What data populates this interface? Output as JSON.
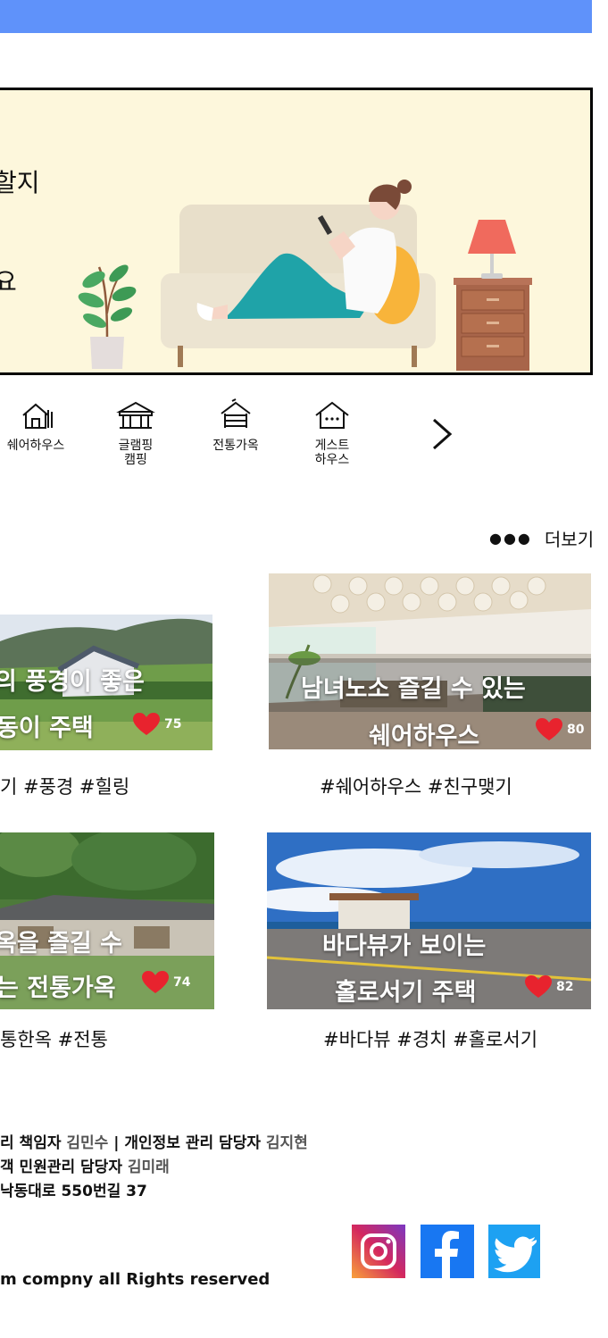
{
  "banner": {
    "line1": "할지",
    "line2": "요"
  },
  "categories": [
    {
      "label": "쉐어하우스",
      "icon": "share-house-icon"
    },
    {
      "label": "글램핑\n캠핑",
      "icon": "glamping-icon"
    },
    {
      "label": "전통가옥",
      "icon": "traditional-house-icon"
    },
    {
      "label": "게스트\n하우스",
      "icon": "guest-house-icon"
    }
  ],
  "more_label": "더보기",
  "cards": [
    {
      "title1": "의 풍경이 좋은",
      "title2": "동이 주택",
      "likes": "75",
      "tags": "기 #풍경 #힐링"
    },
    {
      "title1": "남녀노소 즐길 수 있는",
      "title2": "쉐어하우스",
      "likes": "80",
      "tags": "#쉐어하우스 #친구맺기"
    },
    {
      "title1": "옥을 즐길 수",
      "title2": "는 전통가옥",
      "likes": "74",
      "tags": "통한옥 #전통"
    },
    {
      "title1": "바다뷰가 보이는",
      "title2": "홀로서기 주택",
      "likes": "82",
      "tags": "#바다뷰 #경치 #홀로서기"
    }
  ],
  "footer": {
    "line1_a": "리 책임자 ",
    "line1_b": "김민수",
    "line1_c": " | 개인정보 관리 담당자 ",
    "line1_d": "김지현",
    "line2_a": "객 민원관리 담당자 ",
    "line2_b": "김미래",
    "line3": "낙동대로 550번길 37",
    "copyright": "m compny all Rights reserved"
  },
  "colors": {
    "topbar": "#5f92fa",
    "banner_bg": "#fdf7dc",
    "heart": "#e8232e"
  }
}
